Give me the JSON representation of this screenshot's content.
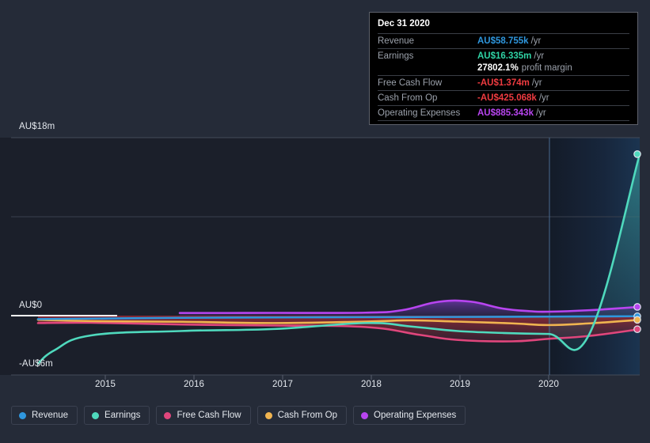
{
  "chart_data": {
    "type": "line",
    "title": "",
    "xlabel": "",
    "ylabel": "",
    "currency": "AU$",
    "x_tick_labels": [
      "2015",
      "2016",
      "2017",
      "2018",
      "2019",
      "2020"
    ],
    "y_tick_labels": [
      "AU$18m",
      "AU$0",
      "-AU$6m"
    ],
    "ylim": [
      -6,
      18
    ],
    "grid": true,
    "legend_position": "bottom",
    "x_range": [
      "2014.4",
      "2021.0"
    ],
    "series": [
      {
        "name": "Revenue",
        "color": "#2f97de",
        "x": [
          2014.42,
          2015.0,
          2016.0,
          2017.0,
          2018.0,
          2019.0,
          2020.0,
          2020.45,
          2021.0
        ],
        "values": [
          -0.35,
          -0.3,
          -0.22,
          -0.18,
          -0.15,
          -0.13,
          -0.1,
          -0.08,
          -0.06
        ]
      },
      {
        "name": "Earnings",
        "color": "#4fd9bd",
        "x": [
          2014.42,
          2014.6,
          2015.0,
          2016.0,
          2017.0,
          2018.0,
          2018.5,
          2019.0,
          2019.5,
          2020.0,
          2020.45,
          2021.0
        ],
        "values": [
          -4.85,
          -3.5,
          -2.0,
          -1.55,
          -1.35,
          -0.75,
          -1.1,
          -1.55,
          -1.75,
          -1.85,
          -1.85,
          16.335
        ]
      },
      {
        "name": "Free Cash Flow",
        "color": "#e0467c",
        "x": [
          2014.42,
          2015.0,
          2016.0,
          2017.0,
          2018.0,
          2018.6,
          2019.0,
          2019.6,
          2020.0,
          2020.45,
          2021.0
        ],
        "values": [
          -0.75,
          -0.72,
          -0.9,
          -1.0,
          -1.15,
          -1.95,
          -2.45,
          -2.6,
          -2.35,
          -2.05,
          -1.374
        ]
      },
      {
        "name": "Cash From Op",
        "color": "#f0b450",
        "x": [
          2014.42,
          2015.0,
          2016.0,
          2017.0,
          2018.0,
          2018.5,
          2019.0,
          2019.6,
          2020.0,
          2020.45,
          2021.0
        ],
        "values": [
          -0.42,
          -0.55,
          -0.62,
          -0.75,
          -0.6,
          -0.48,
          -0.6,
          -0.78,
          -0.95,
          -0.78,
          -0.425
        ]
      },
      {
        "name": "Operating Expenses",
        "color": "#b845f0",
        "x": [
          2015.97,
          2016.5,
          2017.0,
          2018.0,
          2018.4,
          2018.8,
          2019.15,
          2019.5,
          2019.8,
          2020.0,
          2020.45,
          2021.0
        ],
        "values": [
          0.27,
          0.27,
          0.28,
          0.3,
          0.55,
          1.4,
          1.42,
          0.72,
          0.45,
          0.4,
          0.55,
          0.885
        ]
      }
    ],
    "end_markers": [
      {
        "name": "Earnings",
        "color": "#4fd9bd",
        "value": 16.335
      },
      {
        "name": "Operating Expenses",
        "color": "#b845f0",
        "value": 0.885
      },
      {
        "name": "Revenue",
        "color": "#2f97de",
        "value": -0.06
      },
      {
        "name": "Cash From Op",
        "color": "#f0b450",
        "value": -0.425
      },
      {
        "name": "Free Cash Flow",
        "color": "#e0467c",
        "value": -1.374
      }
    ]
  },
  "y_axis": {
    "top": "AU$18m",
    "zero": "AU$0",
    "bottom": "-AU$6m"
  },
  "x_axis": {
    "ticks": [
      {
        "label": "2015"
      },
      {
        "label": "2016"
      },
      {
        "label": "2017"
      },
      {
        "label": "2018"
      },
      {
        "label": "2019"
      },
      {
        "label": "2020"
      }
    ]
  },
  "tooltip": {
    "date": "Dec 31 2020",
    "rows": [
      {
        "label": "Revenue",
        "value": "AU$58.755k",
        "unit": "/yr",
        "color": "#2f97de"
      },
      {
        "label": "Earnings",
        "value": "AU$16.335m",
        "unit": "/yr",
        "color": "#2fd3a5"
      },
      {
        "label": "",
        "value": "27802.1%",
        "unit": "",
        "suffix": "profit margin",
        "color": "#ffffff"
      },
      {
        "label": "Free Cash Flow",
        "value": "-AU$1.374m",
        "unit": "/yr",
        "color": "#ef3b40"
      },
      {
        "label": "Cash From Op",
        "value": "-AU$425.068k",
        "unit": "/yr",
        "color": "#ef3b40"
      },
      {
        "label": "Operating Expenses",
        "value": "AU$885.343k",
        "unit": "/yr",
        "color": "#b845f0"
      }
    ]
  },
  "legend": {
    "items": [
      {
        "label": "Revenue",
        "color": "#2f97de"
      },
      {
        "label": "Earnings",
        "color": "#4fd9bd"
      },
      {
        "label": "Free Cash Flow",
        "color": "#e0467c"
      },
      {
        "label": "Cash From Op",
        "color": "#f0b450"
      },
      {
        "label": "Operating Expenses",
        "color": "#b845f0"
      }
    ]
  },
  "theme": {
    "background": "#252b38",
    "plot_background": "#1b1f2a",
    "plot_background_forecast": "#16263d",
    "gridline": "#3a4150",
    "zero_line": "#ffffff",
    "area_fill_negative": "#6d2432"
  }
}
